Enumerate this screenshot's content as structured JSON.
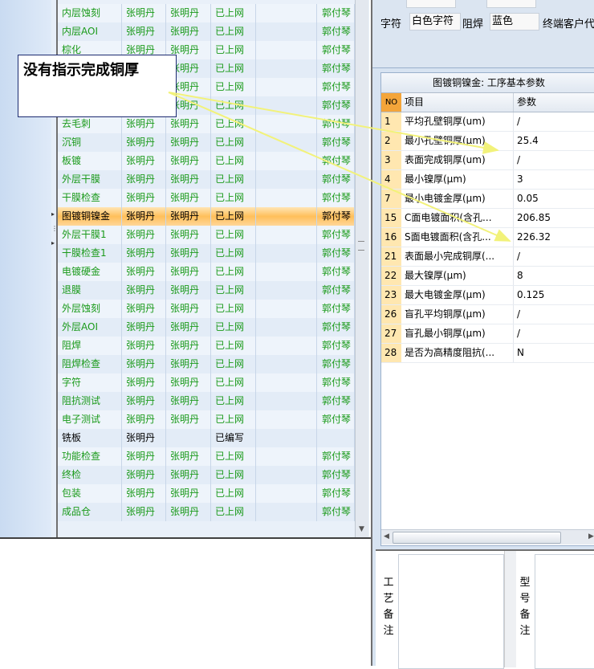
{
  "process_grid": {
    "rows": [
      {
        "name": "内层蚀刻",
        "maker": "张明丹",
        "checker": "张明丹",
        "status": "已上网",
        "approver": "郭付琴"
      },
      {
        "name": "内层AOI",
        "maker": "张明丹",
        "checker": "张明丹",
        "status": "已上网",
        "approver": "郭付琴"
      },
      {
        "name": "棕化",
        "maker": "张明丹",
        "checker": "张明丹",
        "status": "已上网",
        "approver": "郭付琴"
      },
      {
        "name": "",
        "maker": "张明丹",
        "checker": "张明丹",
        "status": "已上网",
        "approver": "郭付琴"
      },
      {
        "name": "",
        "maker": "张明丹",
        "checker": "张明丹",
        "status": "已上网",
        "approver": "郭付琴"
      },
      {
        "name": "",
        "maker": "张明丹",
        "checker": "张明丹",
        "status": "已上网",
        "approver": "郭付琴"
      },
      {
        "name": "去毛刺",
        "maker": "张明丹",
        "checker": "张明丹",
        "status": "已上网",
        "approver": "郭付琴"
      },
      {
        "name": "沉铜",
        "maker": "张明丹",
        "checker": "张明丹",
        "status": "已上网",
        "approver": "郭付琴"
      },
      {
        "name": "板镀",
        "maker": "张明丹",
        "checker": "张明丹",
        "status": "已上网",
        "approver": "郭付琴"
      },
      {
        "name": "外层干膜",
        "maker": "张明丹",
        "checker": "张明丹",
        "status": "已上网",
        "approver": "郭付琴"
      },
      {
        "name": "干膜检查",
        "maker": "张明丹",
        "checker": "张明丹",
        "status": "已上网",
        "approver": "郭付琴"
      },
      {
        "name": "图镀铜镍金",
        "maker": "张明丹",
        "checker": "张明丹",
        "status": "已上网",
        "approver": "郭付琴",
        "selected": true
      },
      {
        "name": "外层干膜1",
        "maker": "张明丹",
        "checker": "张明丹",
        "status": "已上网",
        "approver": "郭付琴"
      },
      {
        "name": "干膜检查1",
        "maker": "张明丹",
        "checker": "张明丹",
        "status": "已上网",
        "approver": "郭付琴"
      },
      {
        "name": "电镀硬金",
        "maker": "张明丹",
        "checker": "张明丹",
        "status": "已上网",
        "approver": "郭付琴"
      },
      {
        "name": "退膜",
        "maker": "张明丹",
        "checker": "张明丹",
        "status": "已上网",
        "approver": "郭付琴"
      },
      {
        "name": "外层蚀刻",
        "maker": "张明丹",
        "checker": "张明丹",
        "status": "已上网",
        "approver": "郭付琴"
      },
      {
        "name": "外层AOI",
        "maker": "张明丹",
        "checker": "张明丹",
        "status": "已上网",
        "approver": "郭付琴"
      },
      {
        "name": "阻焊",
        "maker": "张明丹",
        "checker": "张明丹",
        "status": "已上网",
        "approver": "郭付琴"
      },
      {
        "name": "阻焊检查",
        "maker": "张明丹",
        "checker": "张明丹",
        "status": "已上网",
        "approver": "郭付琴"
      },
      {
        "name": "字符",
        "maker": "张明丹",
        "checker": "张明丹",
        "status": "已上网",
        "approver": "郭付琴"
      },
      {
        "name": "阻抗测试",
        "maker": "张明丹",
        "checker": "张明丹",
        "status": "已上网",
        "approver": "郭付琴"
      },
      {
        "name": "电子测试",
        "maker": "张明丹",
        "checker": "张明丹",
        "status": "已上网",
        "approver": "郭付琴"
      },
      {
        "name": "铣板",
        "maker": "张明丹",
        "checker": "",
        "status": "已编写",
        "approver": "",
        "pending": true
      },
      {
        "name": "功能检查",
        "maker": "张明丹",
        "checker": "张明丹",
        "status": "已上网",
        "approver": "郭付琴"
      },
      {
        "name": "终检",
        "maker": "张明丹",
        "checker": "张明丹",
        "status": "已上网",
        "approver": "郭付琴"
      },
      {
        "name": "包装",
        "maker": "张明丹",
        "checker": "张明丹",
        "status": "已上网",
        "approver": "郭付琴"
      },
      {
        "name": "成品仓",
        "maker": "张明丹",
        "checker": "张明丹",
        "status": "已上网",
        "approver": "郭付琴"
      }
    ],
    "scroll_down_icon": "▼"
  },
  "top_fields": {
    "silkscreen_label": "字符",
    "silkscreen_value": "白色字符",
    "soldermask_label": "阻焊",
    "soldermask_value": "蓝色",
    "end_customer_label": "终端客户代"
  },
  "params": {
    "title": "图镀铜镍金: 工序基本参数",
    "headers": {
      "no": "NO",
      "item": "项目",
      "value": "参数"
    },
    "rows": [
      {
        "no": "1",
        "item": "平均孔壁铜厚(um)",
        "value": "/"
      },
      {
        "no": "2",
        "item": "最小孔壁铜厚(μm)",
        "value": "25.4"
      },
      {
        "no": "3",
        "item": "表面完成铜厚(um)",
        "value": "/"
      },
      {
        "no": "4",
        "item": "最小镍厚(μm)",
        "value": "3"
      },
      {
        "no": "7",
        "item": "最小电镀金厚(μm)",
        "value": "0.05"
      },
      {
        "no": "15",
        "item": "C面电镀面积(含孔...",
        "value": "206.85"
      },
      {
        "no": "16",
        "item": "S面电镀面积(含孔...",
        "value": "226.32"
      },
      {
        "no": "21",
        "item": "表面最小完成铜厚(...",
        "value": "/"
      },
      {
        "no": "22",
        "item": "最大镍厚(μm)",
        "value": "8"
      },
      {
        "no": "23",
        "item": "最大电镀金厚(μm)",
        "value": "0.125"
      },
      {
        "no": "26",
        "item": "盲孔平均铜厚(μm)",
        "value": "/"
      },
      {
        "no": "27",
        "item": "盲孔最小铜厚(μm)",
        "value": "/"
      },
      {
        "no": "28",
        "item": "是否为高精度阻抗(...",
        "value": "N"
      }
    ]
  },
  "remarks": {
    "process_label": "工艺备注",
    "model_label": "型号备注"
  },
  "callout": {
    "text": "没有指示完成铜厚"
  },
  "colors": {
    "approved_text": "#1a9a1a",
    "selected_row": "#ffbf5a",
    "arrow": "#f2f27a",
    "no_column": "#ffe7b0"
  }
}
